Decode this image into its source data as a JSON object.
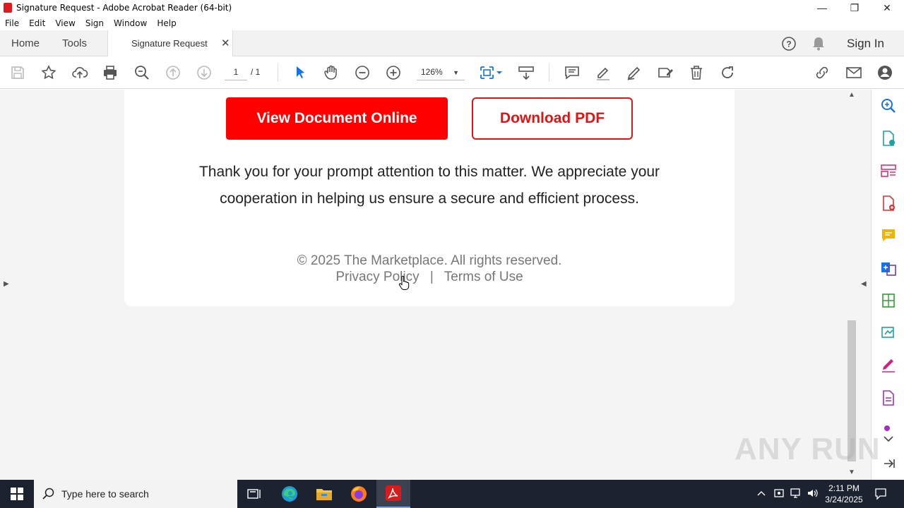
{
  "window": {
    "title": "Signature Request - Adobe Acrobat Reader (64-bit)"
  },
  "menu": [
    "File",
    "Edit",
    "View",
    "Sign",
    "Window",
    "Help"
  ],
  "tabs": {
    "home": "Home",
    "tools": "Tools",
    "document": "Signature Request",
    "sign_in": "Sign In"
  },
  "toolbar": {
    "page_current": "1",
    "page_total": "/ 1",
    "zoom": "126%"
  },
  "document": {
    "view_button": "View Document Online",
    "download_button": "Download PDF",
    "thanks_line1": "Thank you for your prompt attention to this matter. We appreciate your",
    "thanks_line2": "cooperation in helping us ensure a secure and efficient process.",
    "copyright": "© 2025 The Marketplace. All rights reserved.",
    "privacy": "Privacy Policy",
    "separator": "|",
    "terms": "Terms of Use"
  },
  "watermark": "ANY RUN",
  "taskbar": {
    "search_placeholder": "Type here to search",
    "time": "2:11 PM",
    "date": "3/24/2025"
  },
  "colors": {
    "accent_red": "#ff0000",
    "acrobat_blue": "#1473e6"
  }
}
